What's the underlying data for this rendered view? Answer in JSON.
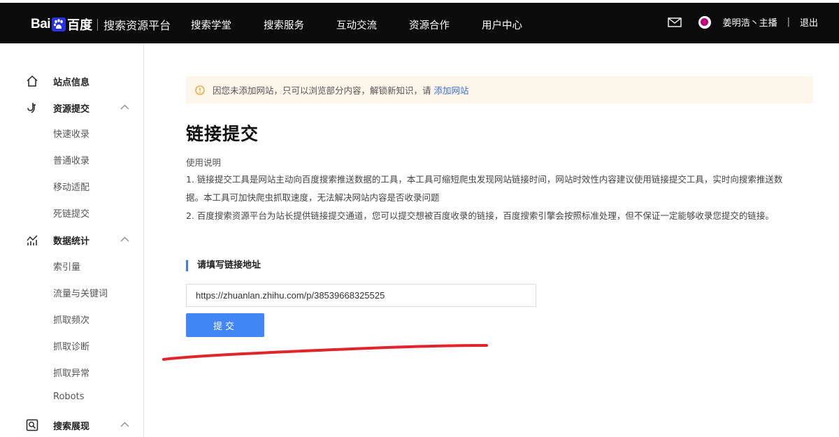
{
  "header": {
    "logo_bai": "Bai",
    "logo_du": "百度",
    "platform": "搜索资源平台",
    "nav": [
      "搜索学堂",
      "搜索服务",
      "互动交流",
      "资源合作",
      "用户中心"
    ],
    "user_name": "姜明浩丶主播",
    "separator": "|",
    "logout": "退出"
  },
  "sidebar": {
    "groups": [
      {
        "label": "站点信息",
        "icon": "home-icon",
        "chevron": false
      },
      {
        "label": "资源提交",
        "icon": "submit-hook-icon",
        "chevron": true,
        "items": [
          "快速收录",
          "普通收录",
          "移动适配",
          "死链提交"
        ]
      },
      {
        "label": "数据统计",
        "icon": "stats-chart-icon",
        "chevron": true,
        "items": [
          "索引量",
          "流量与关键词",
          "抓取频次",
          "抓取诊断",
          "抓取异常",
          "Robots"
        ]
      },
      {
        "label": "搜索展现",
        "icon": "search-display-icon",
        "chevron": true
      }
    ]
  },
  "main": {
    "notice_text": "因您未添加网站，只可以浏览部分内容，解锁新知识，请",
    "notice_link": "添加网站",
    "title": "链接提交",
    "usage_label": "使用说明",
    "desc_lines": [
      "1. 链接提交工具是网站主动向百度搜索推送数据的工具，本工具可缩短爬虫发现网站链接时间，网站时效性内容建议使用链接提交工具，实时向搜索推送数",
      "据。本工具可加快爬虫抓取速度，无法解决网站内容是否收录问题",
      "2. 百度搜索资源平台为站长提供链接提交通道，您可以提交想被百度收录的链接，百度搜索引擎会按照标准处理，但不保证一定能够收录您提交的链接。"
    ],
    "section_label": "请填写链接地址",
    "url_value": "https://zhuanlan.zhihu.com/p/38539668325525",
    "submit_label": "提交"
  },
  "colors": {
    "header_bg": "#0b0b0b",
    "accent": "#4285f4",
    "notice_bg": "#fdf6ea",
    "link": "#3a6fd8",
    "annotation": "#e0262a"
  }
}
